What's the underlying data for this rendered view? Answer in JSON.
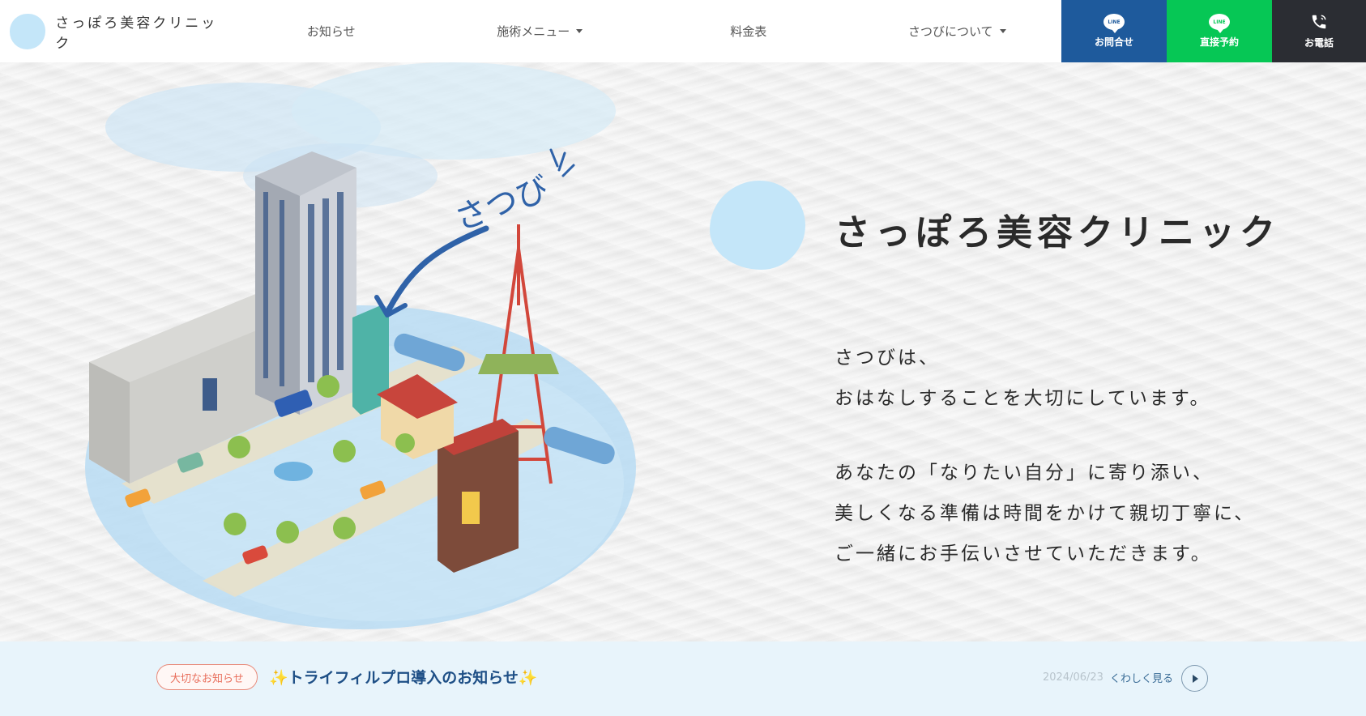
{
  "header": {
    "logo_text": "さっぽろ美容クリニック",
    "nav": [
      {
        "label": "お知らせ",
        "dropdown": false
      },
      {
        "label": "施術メニュー",
        "dropdown": true
      },
      {
        "label": "料金表",
        "dropdown": false
      },
      {
        "label": "さつびについて",
        "dropdown": true
      }
    ],
    "cta": {
      "line_contact": "お問合せ",
      "line_reserve": "直接予約",
      "phone": "お電話",
      "line_icon_text": "LINE"
    }
  },
  "hero": {
    "illustration_caption": "さつび",
    "brand_title": "さっぽろ美容クリニック",
    "lead_lines": [
      "さつびは、",
      "おはなしすることを大切にしています。",
      "あなたの「なりたい自分」に寄り添い、",
      "美しくなる準備は時間をかけて親切丁寧に、",
      "ご一緒にお手伝いさせていただきます。"
    ]
  },
  "news": {
    "badge": "大切なお知らせ",
    "title": "✨トライフィルプロ導入のお知らせ✨",
    "date": "2024/06/23",
    "more": "くわしく見る"
  },
  "colors": {
    "brand_blue_light": "#c4e6f9",
    "line_blue": "#1e5a9c",
    "line_green": "#06c755",
    "phone_dark": "#2b2d33",
    "news_bg": "#e8f4fb"
  }
}
